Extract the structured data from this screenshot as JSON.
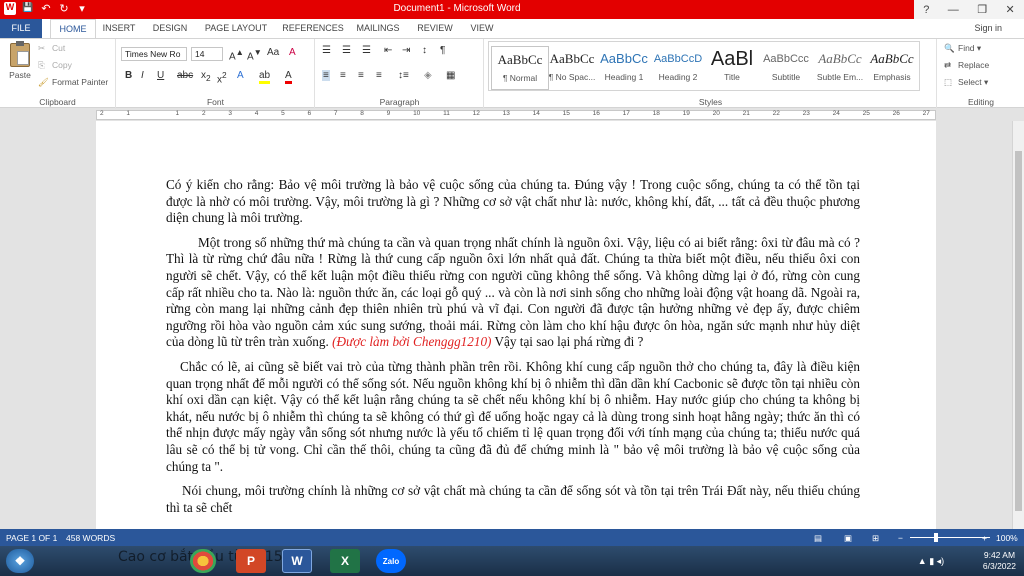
{
  "window": {
    "title": "Document1 - Microsoft Word",
    "help": "?",
    "minimize": "—",
    "restore": "❐",
    "close": "✕"
  },
  "qat": {
    "word_icon": "W",
    "save": "💾",
    "undo": "↶",
    "redo": "↻",
    "customize": "▾"
  },
  "tabs": [
    "FILE",
    "HOME",
    "INSERT",
    "DESIGN",
    "PAGE LAYOUT",
    "REFERENCES",
    "MAILINGS",
    "REVIEW",
    "VIEW"
  ],
  "signin": "Sign in",
  "clipboard": {
    "label": "Clipboard",
    "paste": "Paste",
    "cut": "Cut",
    "copy": "Copy",
    "format_painter": "Format Painter"
  },
  "font": {
    "label": "Font",
    "name": "Times New Ro",
    "size": "14"
  },
  "paragraph": {
    "label": "Paragraph"
  },
  "styles": {
    "label": "Styles",
    "items": [
      {
        "sample": "AaBbCc",
        "name": "¶ Normal"
      },
      {
        "sample": "AaBbCc",
        "name": "¶ No Spac..."
      },
      {
        "sample": "AaBbCc",
        "name": "Heading 1"
      },
      {
        "sample": "AaBbCcD",
        "name": "Heading 2"
      },
      {
        "sample": "AaBl",
        "name": "Title"
      },
      {
        "sample": "AaBbCcc",
        "name": "Subtitle"
      },
      {
        "sample": "AaBbCc",
        "name": "Subtle Em..."
      },
      {
        "sample": "AaBbCc",
        "name": "Emphasis"
      }
    ]
  },
  "editing": {
    "label": "Editing",
    "find": "Find",
    "replace": "Replace",
    "select": "Select"
  },
  "ruler_numbers": [
    "2",
    "1",
    "",
    "1",
    "2",
    "3",
    "4",
    "5",
    "6",
    "7",
    "8",
    "9",
    "10",
    "11",
    "12",
    "13",
    "14",
    "15",
    "16",
    "17",
    "18",
    "19",
    "20",
    "21",
    "22",
    "23",
    "24",
    "25",
    "26",
    "27"
  ],
  "document": {
    "p1": "Có ý kiến cho rằng: Bảo vệ môi trường là bảo vệ cuộc sống của chúng ta. Đúng vậy ! Trong cuộc sống, chúng ta có thể tồn tại được là nhờ có môi trường. Vậy, môi trường là gì ? Những cơ sở vật chất như là: nước, không khí, đất, ... tất cả đều thuộc phương diện chung là môi trường.",
    "p2a": "Một trong số những thứ mà chúng ta cần và quan trọng nhất chính là nguồn ôxi. Vậy, liệu có ai biết rằng: ôxi từ đâu mà có ? Thì là từ rừng chứ đâu nữa ! Rừng là thứ cung cấp nguồn ôxi lớn nhất quả đất. Chúng ta thừa biết một điều, nếu thiếu ôxi con người sẽ chết. Vậy, có thể kết luận một điều thiếu rừng con người cũng không thể sống. Và không dừng lại ở đó, rừng còn cung cấp rất nhiều cho ta. Nào là: nguồn thức ăn, các loại gỗ quý ... và còn là nơi sinh sống cho những loài động vật hoang dã. Ngoài ra, rừng còn mang lại những cảnh đẹp thiên nhiên trù phú và vĩ đại. Con người đã được tận hưởng những vẻ đẹp ấy, được chiêm ngưỡng rồi hòa vào nguồn cảm xúc sung sướng, thoải mái. Rừng còn làm cho khí hậu được ôn hòa, ngăn sức mạnh như hủy diệt của dòng lũ từ trên tràn xuống.",
    "p2_red": "(Được làm bởi Chenggg1210)",
    "p2b": "Vậy tại sao lại phá rừng đi ?",
    "p3": "Chắc có lẽ, ai cũng sẽ biết vai trò của từng thành phần trên rồi. Không khí cung cấp nguồn thở cho chúng ta, đây là điều kiện quan trọng nhất để mỗi người có thể sống sót. Nếu nguồn không khí bị ô nhiễm thì dần dần khí Cacbonic sẽ được tồn tại nhiều còn khí oxi dần cạn kiệt. Vậy có thể kết luận rằng chúng ta sẽ chết nếu không khí bị ô nhiễm. Hay nước giúp cho chúng ta không bị khát, nếu nước bị ô nhiễm thì chúng ta sẽ không có thứ gì để uống hoặc ngay cả là dùng trong sinh hoạt hằng ngày; thức ăn thì có thể nhịn được mấy ngày vẫn sống sót nhưng nước là yếu tố chiếm tỉ lệ quan trọng đối với tính mạng của chúng ta; thiếu nước quá lâu sẽ có thể bị tử vong. Chỉ cần thế thôi, chúng ta cũng đã đủ để chứng minh là \" bảo vệ môi trường là bảo vệ cuộc sống của chúng ta \".",
    "p4": "Nói chung, môi trường chính là những cơ sở vật chất mà chúng ta cần để sống sót và tồn tại trên Trái Đất này, nếu thiếu chúng thì ta sẽ chết"
  },
  "status": {
    "page": "PAGE 1 OF 1",
    "words": "458 WORDS",
    "zoom": "100%"
  },
  "taskbar": {
    "banner": "Cao cơ bắt đầu từ 7h15",
    "zalo": "Zalo",
    "time": "9:42 AM",
    "date": "6/3/2022"
  }
}
